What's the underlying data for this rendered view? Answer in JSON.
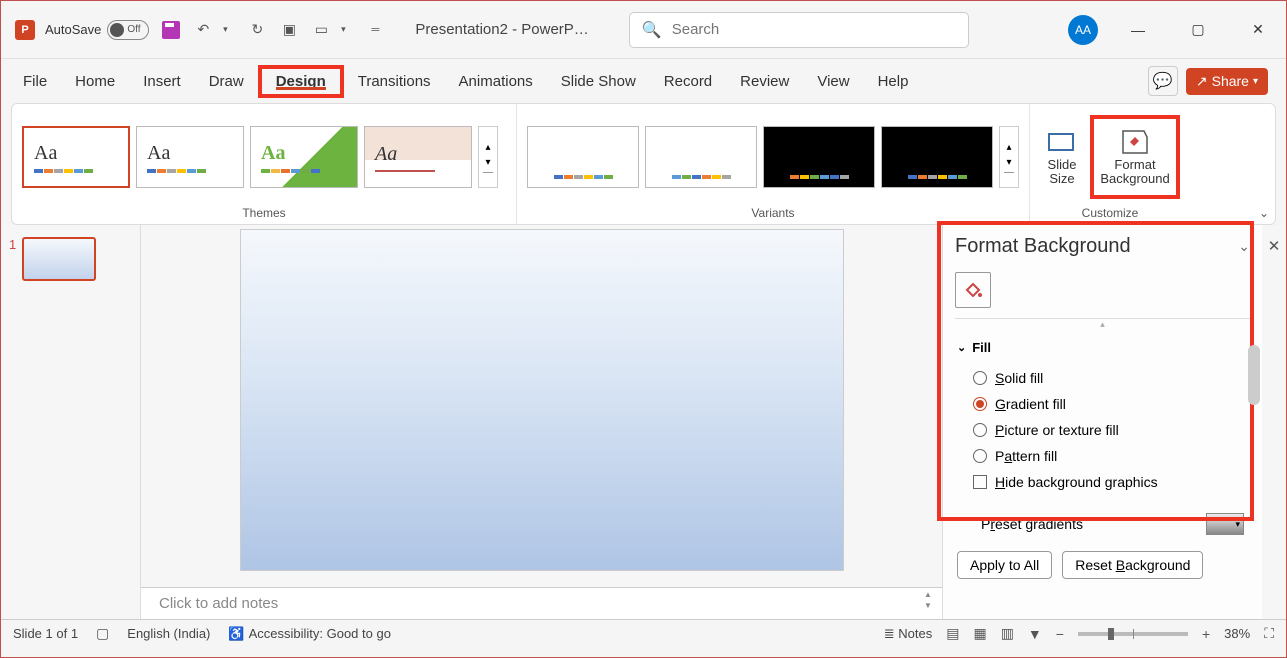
{
  "titlebar": {
    "autosave_label": "AutoSave",
    "autosave_state": "Off",
    "doc_title": "Presentation2 - PowerP…",
    "search_placeholder": "Search",
    "avatar": "AA"
  },
  "tabs": [
    "File",
    "Home",
    "Insert",
    "Draw",
    "Design",
    "Transitions",
    "Animations",
    "Slide Show",
    "Record",
    "Review",
    "View",
    "Help"
  ],
  "active_tab": "Design",
  "share_label": "Share",
  "ribbon": {
    "themes_label": "Themes",
    "variants_label": "Variants",
    "customize_label": "Customize",
    "slide_size": "Slide Size",
    "format_bg": "Format Background"
  },
  "thumb": {
    "num": "1"
  },
  "pane": {
    "title": "Format Background",
    "section": "Fill",
    "solid": "Solid fill",
    "gradient": "Gradient fill",
    "picture": "Picture or texture fill",
    "pattern": "Pattern fill",
    "hide": "Hide background graphics",
    "preset": "Preset gradients",
    "apply_all": "Apply to All",
    "reset": "Reset Background"
  },
  "notes_placeholder": "Click to add notes",
  "status": {
    "slide": "Slide 1 of 1",
    "lang": "English (India)",
    "acc": "Accessibility: Good to go",
    "notes": "Notes",
    "zoom": "38%"
  }
}
